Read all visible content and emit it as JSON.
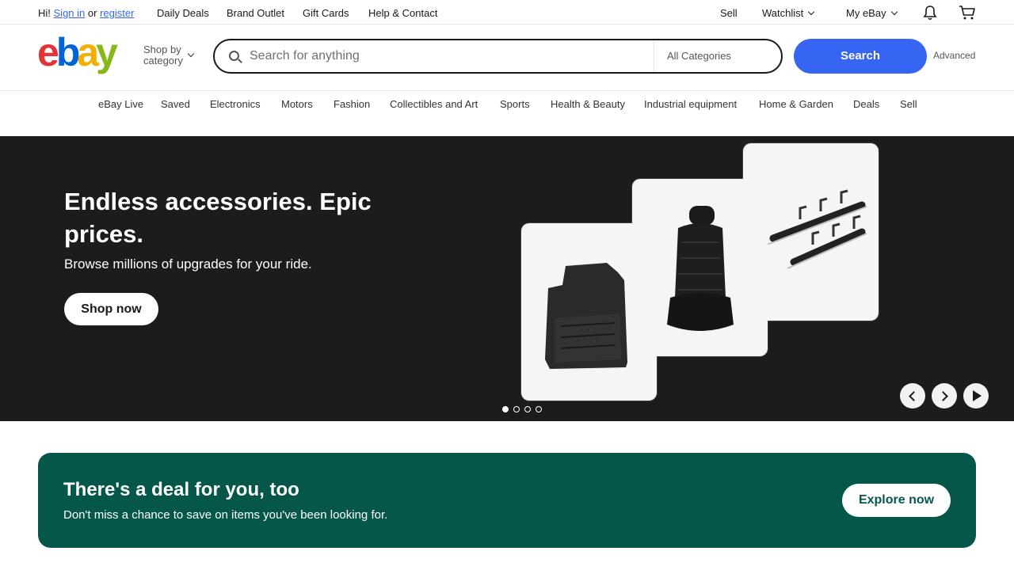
{
  "topbar": {
    "greeting": "Hi!",
    "sign_in": "Sign in",
    "or": "or",
    "register": "register",
    "links": [
      "Daily Deals",
      "Brand Outlet",
      "Gift Cards",
      "Help & Contact"
    ],
    "sell": "Sell",
    "watchlist": "Watchlist",
    "my_ebay": "My eBay",
    "bell_icon": "bell-icon",
    "cart_icon": "cart-icon"
  },
  "header": {
    "logo": {
      "e": "e",
      "b": "b",
      "a": "a",
      "y": "y"
    },
    "shop_by_line1": "Shop by",
    "shop_by_line2": "category",
    "search_placeholder": "Search for anything",
    "category_select": "All Categories",
    "search_button": "Search",
    "advanced": "Advanced"
  },
  "nav": [
    "eBay Live",
    "Saved",
    "Electronics",
    "Motors",
    "Fashion",
    "Collectibles and Art",
    "Sports",
    "Health & Beauty",
    "Industrial equipment",
    "Home & Garden",
    "Deals",
    "Sell"
  ],
  "hero": {
    "title": "Endless accessories. Epic prices.",
    "subtitle": "Browse millions of upgrades for your ride.",
    "cta": "Shop now",
    "slides_total": 4,
    "active_slide": 1
  },
  "deal_banner": {
    "title": "There's a deal for you, too",
    "subtitle": "Don't miss a chance to save on items you've been looking for.",
    "cta": "Explore now"
  },
  "colors": {
    "accent": "#3665f3",
    "hero_bg": "#1c1c1c",
    "deal_bg": "#05574a",
    "logo_red": "#e53238",
    "logo_blue": "#0064d2",
    "logo_yellow": "#f5af02",
    "logo_green": "#86b817"
  }
}
